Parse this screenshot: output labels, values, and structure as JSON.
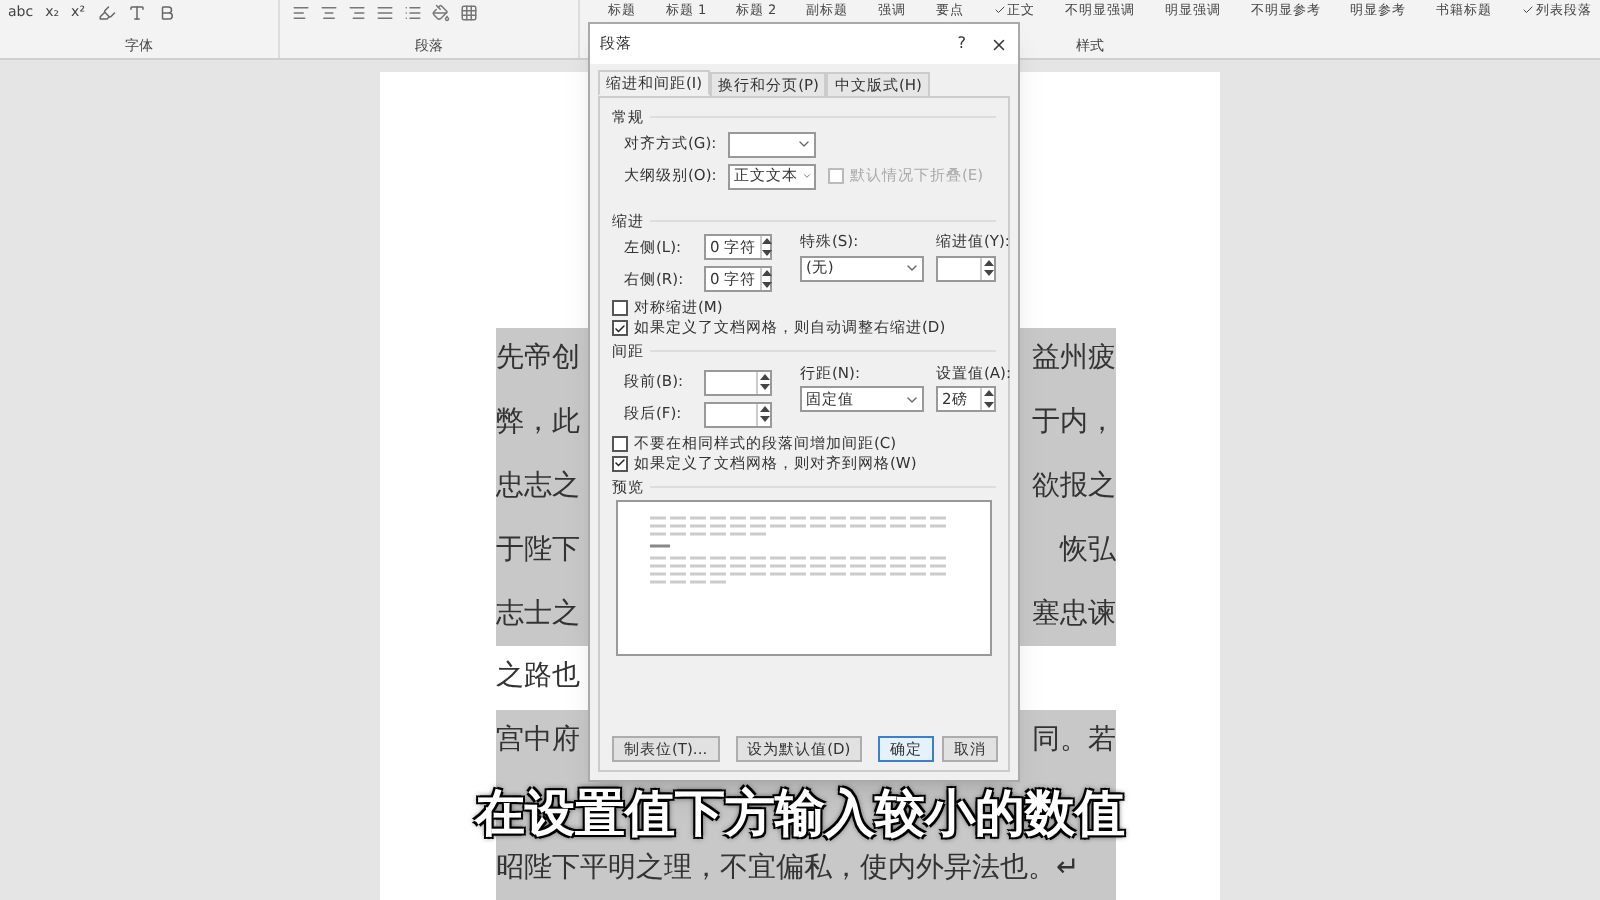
{
  "ribbon": {
    "font_tools": [
      "abc",
      "x₂",
      "x²"
    ],
    "styles": [
      {
        "label": "标题",
        "checked": false
      },
      {
        "label": "标题 1",
        "checked": false
      },
      {
        "label": "标题 2",
        "checked": false
      },
      {
        "label": "副标题",
        "checked": false
      },
      {
        "label": "强调",
        "checked": false
      },
      {
        "label": "要点",
        "checked": false
      },
      {
        "label": "正文",
        "checked": true
      },
      {
        "label": "不明显强调",
        "checked": false
      },
      {
        "label": "明显强调",
        "checked": false
      },
      {
        "label": "不明显参考",
        "checked": false
      },
      {
        "label": "明显参考",
        "checked": false
      },
      {
        "label": "书籍标题",
        "checked": false
      },
      {
        "label": "列表段落",
        "checked": true
      }
    ],
    "groups": [
      "字体",
      "段落",
      "样式"
    ]
  },
  "document": {
    "lines": [
      {
        "left": "先帝创",
        "right": "益州疲",
        "highlighted": true
      },
      {
        "left": "弊，此",
        "right": "于内，",
        "highlighted": true
      },
      {
        "left": "忠志之",
        "right": "欲报之",
        "highlighted": true
      },
      {
        "left": "于陛下",
        "right": "恢弘",
        "highlighted": true
      },
      {
        "left": "志士之",
        "right": "塞忠谏",
        "highlighted": true
      },
      {
        "left": "之路也",
        "highlighted": false
      },
      {
        "left": "宫中府",
        "right": "同。若",
        "highlighted": true
      }
    ],
    "last_line": "昭陛下平明之理，不宜偏私，使内外异法也。↵"
  },
  "dialog": {
    "title": "段落",
    "help": "?",
    "tabs": [
      {
        "label": "缩进和间距(I)",
        "selected": true
      },
      {
        "label": "换行和分页(P)",
        "selected": false
      },
      {
        "label": "中文版式(H)",
        "selected": false
      }
    ],
    "general": {
      "heading": "常规",
      "alignment_label": "对齐方式(G):",
      "outline_label": "大纲级别(O):",
      "outline_value": "正文文本",
      "collapse": {
        "label": "默认情况下折叠(E)",
        "checked": false,
        "disabled": true
      }
    },
    "indent": {
      "heading": "缩进",
      "left_label": "左侧(L):",
      "left_value": "0 字符",
      "right_label": "右侧(R):",
      "right_value": "0 字符",
      "special_label": "特殊(S):",
      "special_value": "(无)",
      "by_label": "缩进值(Y):",
      "checks": [
        {
          "label": "对称缩进(M)",
          "checked": false
        },
        {
          "label": "如果定义了文档网格，则自动调整右缩进(D)",
          "checked": true
        }
      ]
    },
    "spacing": {
      "heading": "间距",
      "before_label": "段前(B):",
      "after_label": "段后(F):",
      "line_label": "行距(N):",
      "line_value": "固定值",
      "at_label": "设置值(A):",
      "at_value": "2磅",
      "checks": [
        {
          "label": "不要在相同样式的段落间增加间距(C)",
          "checked": false
        },
        {
          "label": "如果定义了文档网格，则对齐到网格(W)",
          "checked": true
        }
      ]
    },
    "preview": {
      "heading": "预览"
    },
    "buttons": [
      "制表位(T)...",
      "设为默认值(D)",
      "确定",
      "取消"
    ]
  },
  "subtitle": "在设置值下方输入较小的数值"
}
